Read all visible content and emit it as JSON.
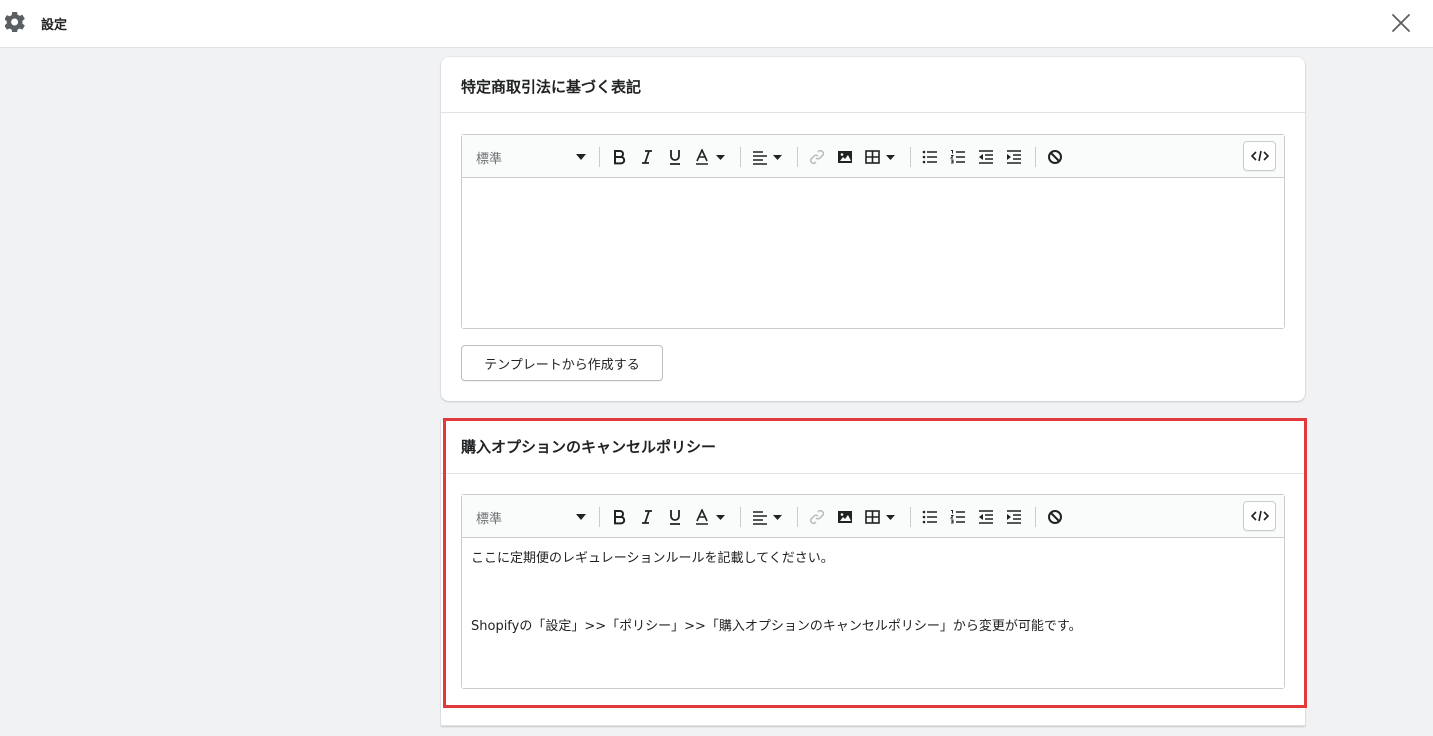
{
  "topbar": {
    "title": "設定",
    "icon_left": "gear-icon",
    "icon_right": "close-icon"
  },
  "cards": {
    "legal": {
      "title": "特定商取引法に基づく表記",
      "toolbar_style": "標準",
      "content": "",
      "template_button": "テンプレートから作成する"
    },
    "cancel_policy": {
      "title": "購入オプションのキャンセルポリシー",
      "toolbar_style": "標準",
      "content_line1": "ここに定期便のレギュレーションルールを記載してください。",
      "content_line2": "Shopifyの「設定」>>「ポリシー」>>「購入オプションのキャンセルポリシー」から変更が可能です。"
    }
  },
  "toolbar_icons": [
    "bold-icon",
    "italic-icon",
    "underline-icon",
    "text-color-icon",
    "align-icon",
    "link-icon",
    "image-icon",
    "table-icon",
    "bullet-list-icon",
    "numbered-list-icon",
    "outdent-icon",
    "indent-icon",
    "clear-format-icon",
    "html-code-icon"
  ],
  "colors": {
    "highlight": "#e03a3a",
    "background": "#f1f2f4"
  }
}
